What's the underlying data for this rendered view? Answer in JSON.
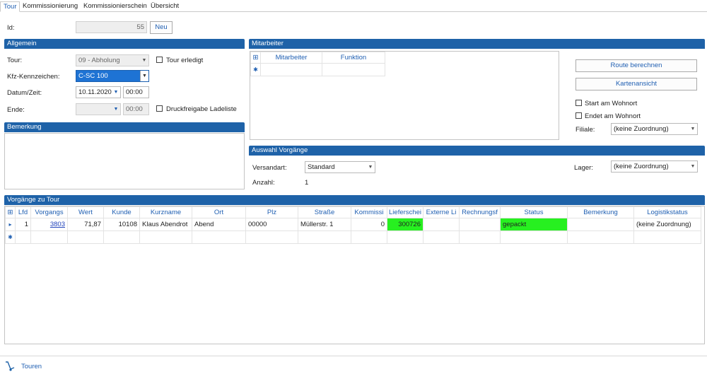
{
  "tabs": [
    "Tour",
    "Kommissionierung",
    "Kommissionierschein",
    "Übersicht"
  ],
  "id_label": "Id:",
  "id_value": "55",
  "neu_button": "Neu",
  "allgemein": {
    "title": "Allgemein",
    "tour_label": "Tour:",
    "tour_value": "09 - Abholung",
    "tour_erledigt": "Tour erledigt",
    "kfz_label": "Kfz-Kennzeichen:",
    "kfz_value": "C-SC 100",
    "datum_label": "Datum/Zeit:",
    "datum_value": "10.11.2020",
    "zeit_value": "00:00",
    "ende_label": "Ende:",
    "ende_date": "",
    "ende_time": "00:00",
    "druckfreigabe": "Druckfreigabe Ladeliste"
  },
  "bemerkung": {
    "title": "Bemerkung"
  },
  "mitarbeiter": {
    "title": "Mitarbeiter",
    "columns": [
      "Mitarbeiter",
      "Funktion"
    ],
    "new_row_marker": "✱"
  },
  "right_panel": {
    "route_button": "Route berechnen",
    "karten_button": "Kartenansicht",
    "start_wohnort": "Start am Wohnort",
    "ende_wohnort": "Endet am Wohnort",
    "filiale_label": "Filiale:",
    "filiale_value": "(keine Zuordnung)"
  },
  "auswahl": {
    "title": "Auswahl Vorgänge",
    "versandart_label": "Versandart:",
    "versandart_value": "Standard",
    "lager_label": "Lager:",
    "lager_value": "(keine Zuordnung)",
    "anzahl_label": "Anzahl:",
    "anzahl_value": "1"
  },
  "vorgaenge": {
    "title": "Vorgänge zu Tour",
    "columns": [
      "Lfd",
      "Vorgangs",
      "Wert",
      "Kunde",
      "Kurzname",
      "Ort",
      "Plz",
      "Straße",
      "Kommissi",
      "Lieferschei",
      "Externe Li",
      "Rechnungsf",
      "Status",
      "Bemerkung",
      "Logistikstatus"
    ],
    "rows": [
      {
        "lfd": "1",
        "vorgang": "3803",
        "wert": "71,87",
        "kunde": "10108",
        "kurzname": "Klaus Abendrot",
        "ort": "Abend",
        "plz": "00000",
        "strasse": "Müllerstr. 1",
        "kommissi": "0",
        "lieferschein": "300726",
        "externe": "",
        "rechnung": "",
        "status": "gepackt",
        "bemerkung": "",
        "logistik": "(keine Zuordnung)"
      }
    ],
    "row_indicator": "▸",
    "new_row_marker": "✱"
  },
  "footer": {
    "label": "Touren"
  },
  "colors": {
    "header_blue": "#1e62a8",
    "status_green": "#27f020",
    "selection_blue": "#1e73d4"
  }
}
